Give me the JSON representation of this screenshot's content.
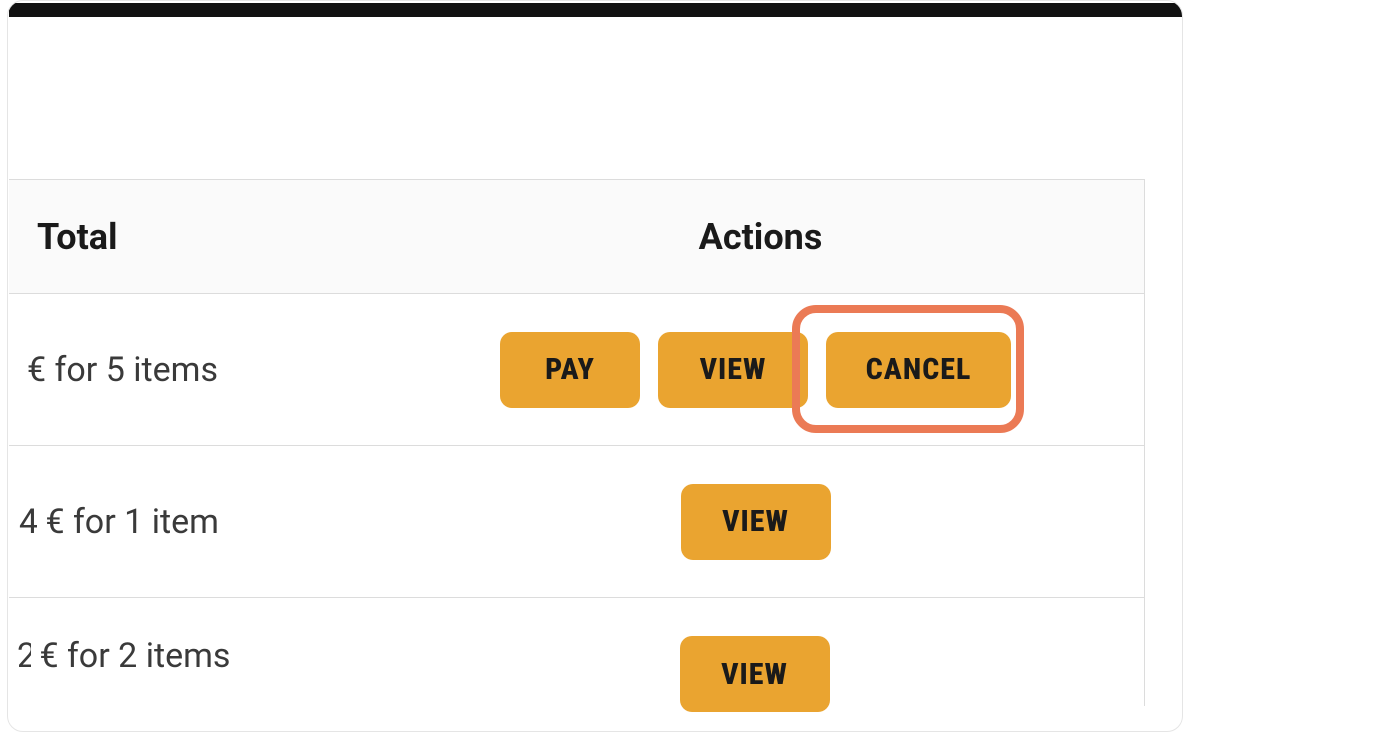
{
  "table": {
    "headers": {
      "total": "Total",
      "actions": "Actions"
    },
    "rows": [
      {
        "total_text": "€ for 5 items",
        "actions": {
          "pay": "PAY",
          "view": "VIEW",
          "cancel": "CANCEL"
        },
        "has_pay": true,
        "has_cancel": true,
        "cancel_highlighted": true
      },
      {
        "total_text": "€ for 1 item",
        "prefix": "4",
        "actions": {
          "view": "VIEW"
        },
        "has_pay": false,
        "has_cancel": false
      },
      {
        "total_text": "€ for 2 items",
        "prefix": "2",
        "actions": {
          "view": "VIEW"
        },
        "has_pay": false,
        "has_cancel": false
      }
    ]
  },
  "colors": {
    "button_bg": "#eaa430",
    "highlight_ring": "#eb7a55"
  }
}
